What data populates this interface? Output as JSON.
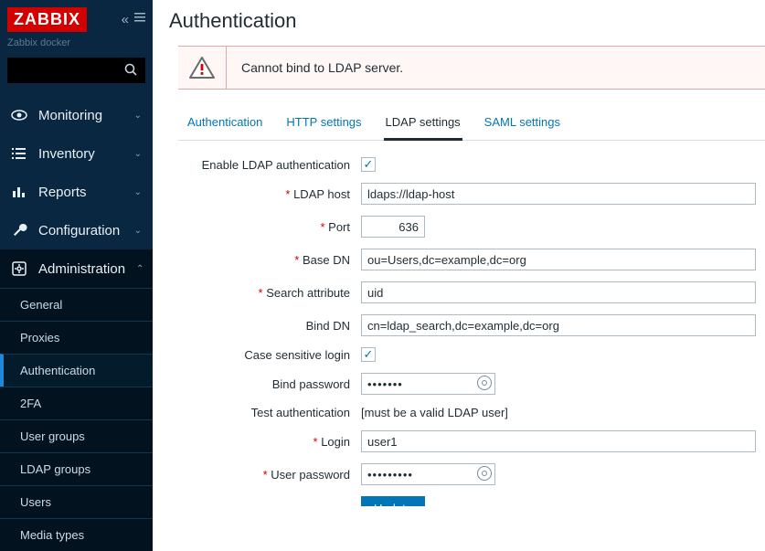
{
  "sidebar": {
    "logo": "ZABBIX",
    "server_name": "Zabbix docker",
    "search_placeholder": "",
    "items": [
      {
        "label": "Monitoring"
      },
      {
        "label": "Inventory"
      },
      {
        "label": "Reports"
      },
      {
        "label": "Configuration"
      },
      {
        "label": "Administration"
      }
    ],
    "admin_sub": [
      {
        "label": "General"
      },
      {
        "label": "Proxies"
      },
      {
        "label": "Authentication"
      },
      {
        "label": "2FA"
      },
      {
        "label": "User groups"
      },
      {
        "label": "LDAP groups"
      },
      {
        "label": "Users"
      },
      {
        "label": "Media types"
      }
    ]
  },
  "page": {
    "title": "Authentication",
    "alert": "Cannot bind to LDAP server."
  },
  "tabs": [
    {
      "label": "Authentication"
    },
    {
      "label": "HTTP settings"
    },
    {
      "label": "LDAP settings"
    },
    {
      "label": "SAML settings"
    }
  ],
  "form": {
    "enable_ldap_label": "Enable LDAP authentication",
    "enable_ldap_checked": true,
    "ldap_host_label": "LDAP host",
    "ldap_host": "ldaps://ldap-host",
    "port_label": "Port",
    "port": "636",
    "base_dn_label": "Base DN",
    "base_dn": "ou=Users,dc=example,dc=org",
    "search_attr_label": "Search attribute",
    "search_attr": "uid",
    "bind_dn_label": "Bind DN",
    "bind_dn": "cn=ldap_search,dc=example,dc=org",
    "case_sensitive_label": "Case sensitive login",
    "case_sensitive_checked": true,
    "bind_pwd_label": "Bind password",
    "bind_pwd": "•••••••",
    "test_auth_label": "Test authentication",
    "test_auth_hint": "[must be a valid LDAP user]",
    "login_label": "Login",
    "login": "user1",
    "user_pwd_label": "User password",
    "user_pwd": "•••••••••",
    "update_btn": "Update"
  }
}
